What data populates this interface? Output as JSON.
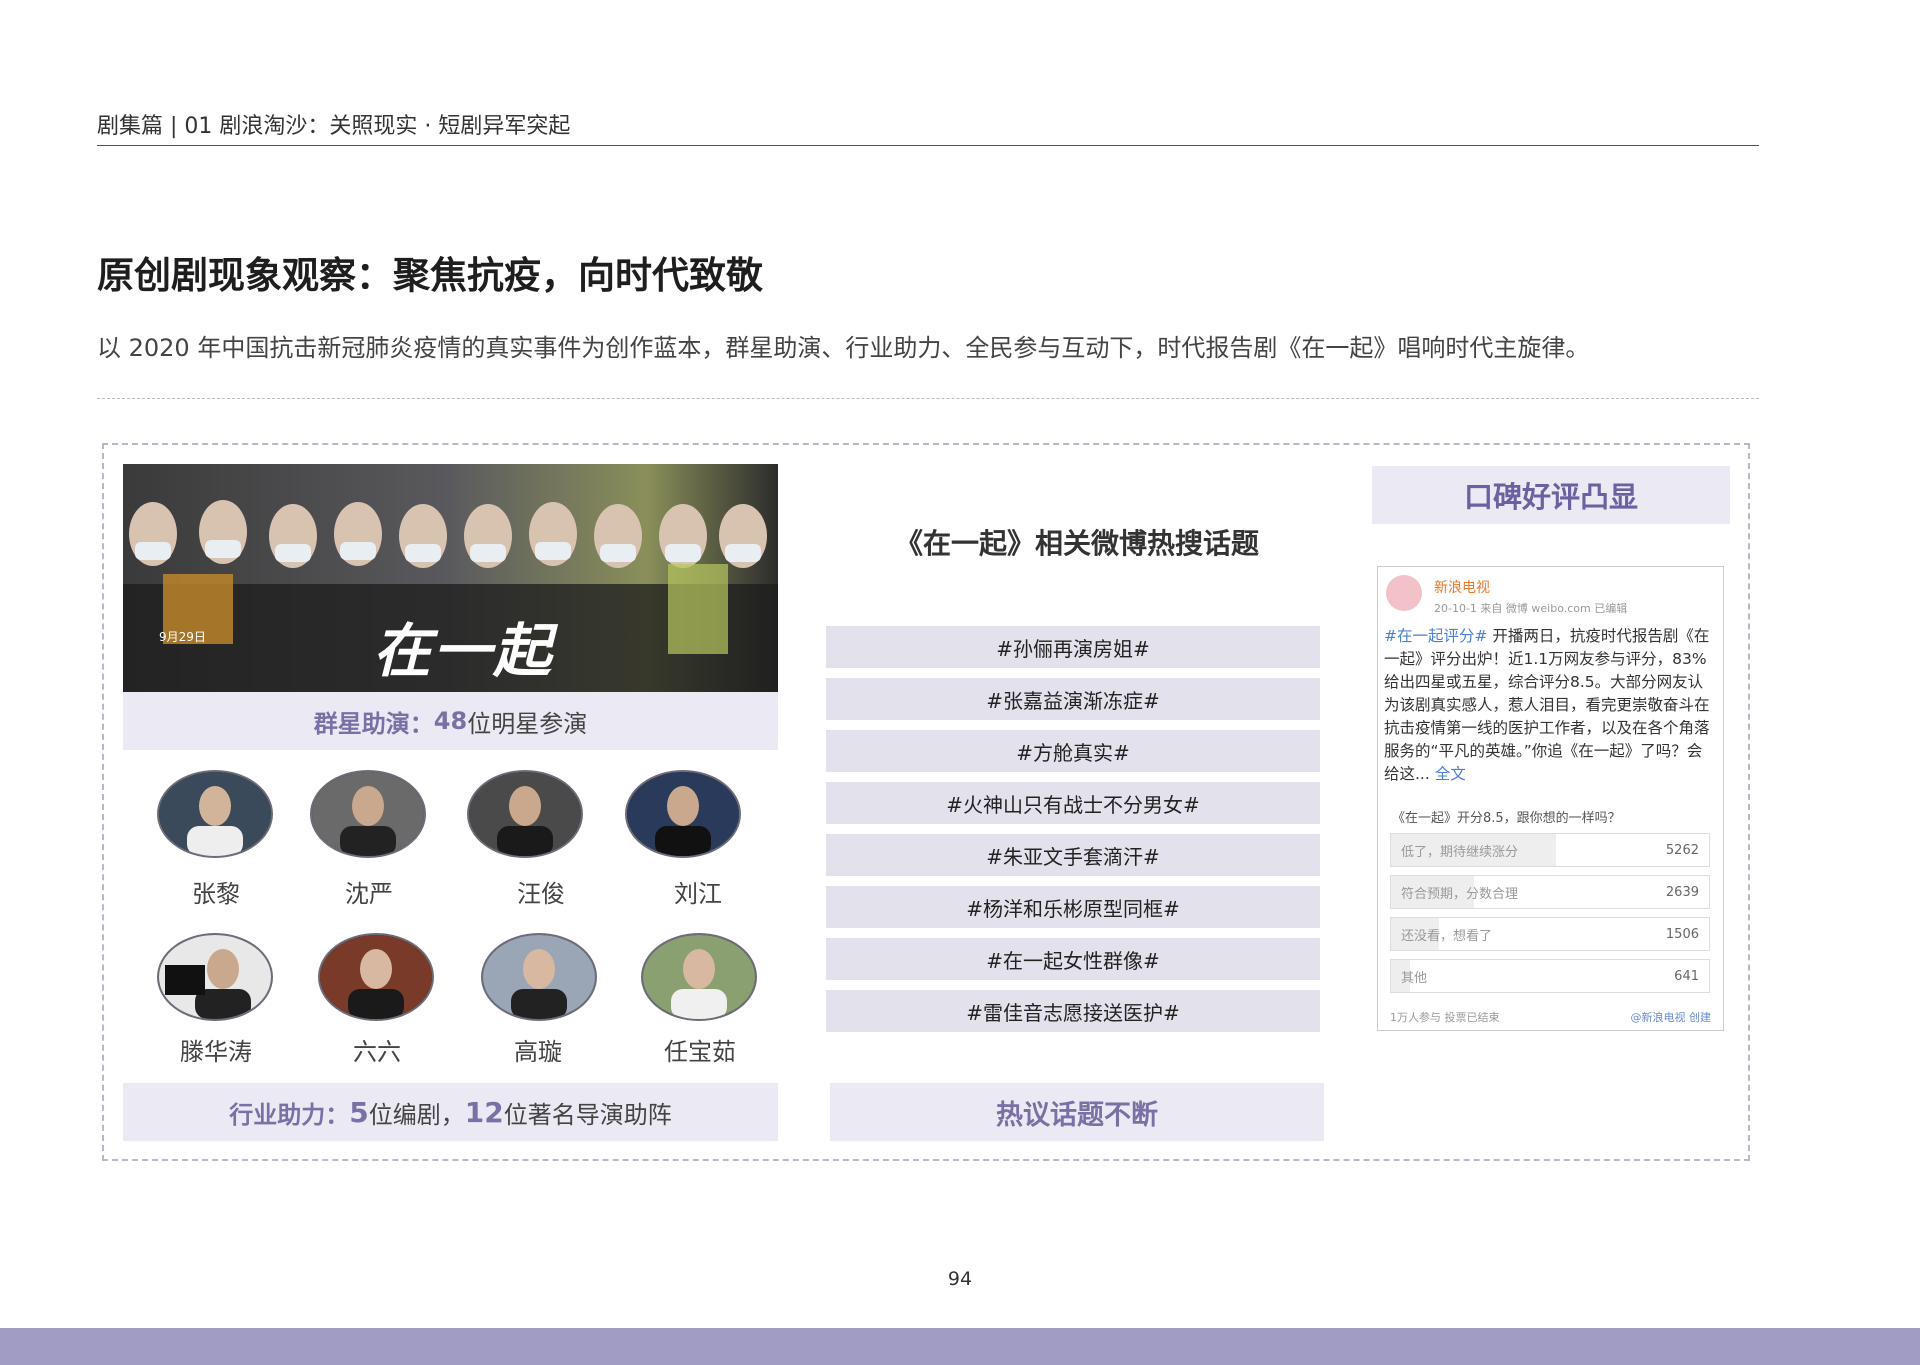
{
  "header": {
    "section": "剧集篇 | 01  剧浪淘沙：关照现实 · 短剧异军突起"
  },
  "title": "原创剧现象观察：聚焦抗疫，向时代致敬",
  "subtitle": "以 2020 年中国抗击新冠肺炎疫情的真实事件为创作蓝本，群星助演、行业助力、全民参与互动下，时代报告剧《在一起》唱响时代主旋律。",
  "poster": {
    "title": "在一起",
    "date": "9月29日"
  },
  "star_band": {
    "label": "群星助演：",
    "count": "48",
    "suffix": "位明星参演"
  },
  "cast": [
    {
      "name": "张黎"
    },
    {
      "name": "沈严"
    },
    {
      "name": "汪俊"
    },
    {
      "name": "刘江"
    },
    {
      "name": "滕华涛"
    },
    {
      "name": "六六"
    },
    {
      "name": "高璇"
    },
    {
      "name": "任宝茹"
    }
  ],
  "industry_band": {
    "label": "行业助力：",
    "writers": "5",
    "writers_suffix": "位编剧，",
    "directors": "12",
    "directors_suffix": "位著名导演助阵"
  },
  "topics": {
    "heading": "《在一起》相关微博热搜话题",
    "items": [
      "#孙俪再演房姐#",
      "#张嘉益演渐冻症#",
      "#方舱真实#",
      "#火神山只有战士不分男女#",
      "#朱亚文手套滴汗#",
      "#杨洋和乐彬原型同框#",
      "#在一起女性群像#",
      "#雷佳音志愿接送医护#"
    ],
    "band": "热议话题不断"
  },
  "praise": {
    "band": "口碑好评凸显"
  },
  "weibo": {
    "account": "新浪电视",
    "meta": "20-10-1  来自 微博 weibo.com  已编辑",
    "tag": "#在一起评分#",
    "body": " 开播两日，抗疫时代报告剧《在一起》评分出炉！近1.1万网友参与评分，83%给出四星或五星，综合评分8.5。大部分网友认为该剧真实感人，惹人泪目，看完更崇敬奋斗在抗击疫情第一线的医护工作者，以及在各个角落服务的“平凡的英雄。”你追《在一起》了吗？会给这...",
    "more": "全文",
    "poll_question": "《在一起》开分8.5，跟你想的一样吗？",
    "options": [
      {
        "label": "低了，期待继续涨分",
        "count": "5262",
        "share": 0.52
      },
      {
        "label": "符合预期，分数合理",
        "count": "2639",
        "share": 0.26
      },
      {
        "label": "还没看，想看了",
        "count": "1506",
        "share": 0.15
      },
      {
        "label": "其他",
        "count": "641",
        "share": 0.06
      }
    ],
    "footer_left": "1万人参与  投票已结束",
    "footer_right": "@新浪电视 创建"
  },
  "page_number": "94",
  "colors": {
    "accent": "#7b70a6",
    "band": "#ebeaf4",
    "topic": "#e3e2ec",
    "footer": "#a09cc4"
  }
}
